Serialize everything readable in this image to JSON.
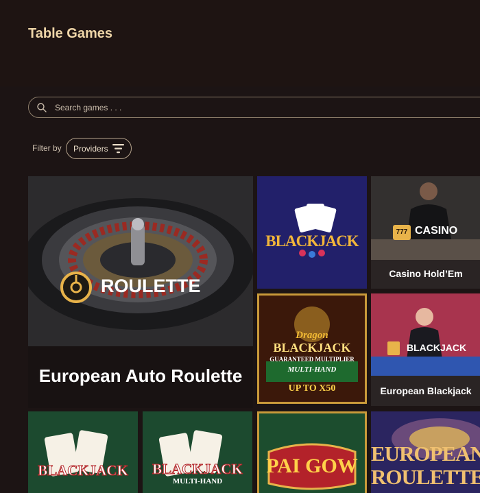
{
  "page": {
    "title": "Table Games"
  },
  "search": {
    "placeholder": "Search games . . ."
  },
  "filter": {
    "label": "Filter by",
    "providers_label": "Providers"
  },
  "games": [
    {
      "title": "European Auto Roulette",
      "art_text": "ROULETTE"
    },
    {
      "title": "",
      "art_text": "BLACKJACK"
    },
    {
      "title": "Casino Hold’Em",
      "art_text": "CASINO"
    },
    {
      "title": "",
      "art_text_1": "Dragon",
      "art_text_2": "BLACKJACK",
      "art_text_3": "GUARANTEED MULTIPLIER",
      "art_text_4": "MULTI-HAND",
      "art_text_5": "UP TO X50"
    },
    {
      "title": "European Blackjack",
      "art_text": "BLACKJACK"
    },
    {
      "title": "",
      "art_text": "BLACKJACK"
    },
    {
      "title": "",
      "art_text_1": "BLACKJACK",
      "art_text_2": "MULTI-HAND"
    },
    {
      "title": "",
      "art_text": "PAI GOW"
    },
    {
      "title": "",
      "art_text_1": "EUROPEAN",
      "art_text_2": "ROULETTE"
    }
  ],
  "colors": {
    "background": "#1c1414",
    "title": "#efd6a8",
    "accent_gold": "#e8b34a"
  }
}
